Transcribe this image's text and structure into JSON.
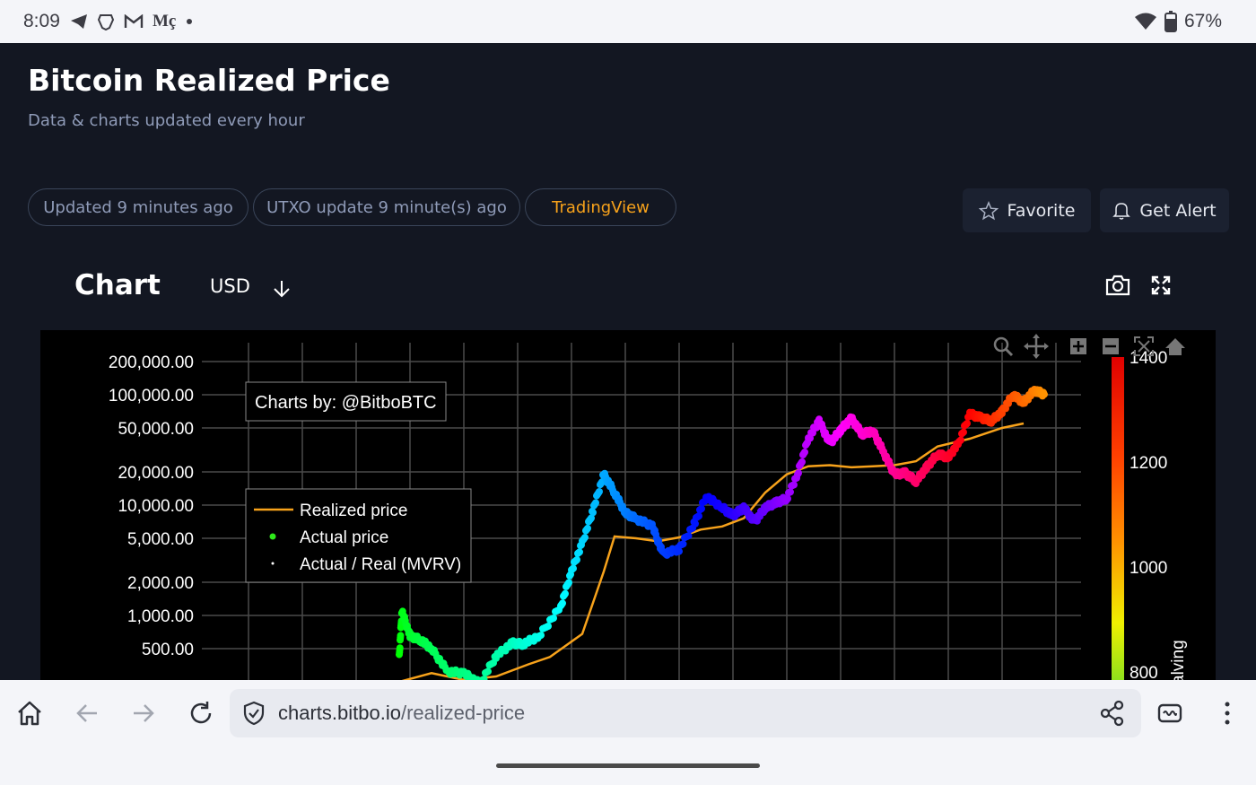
{
  "status_bar": {
    "time": "8:09",
    "notif_text": "Mç",
    "battery": "67%"
  },
  "page": {
    "title": "Bitcoin Realized Price",
    "subtitle": "Data & charts updated every hour",
    "pills": [
      "Updated 9 minutes ago",
      "UTXO update 9 minute(s) ago",
      "TradingView"
    ],
    "favorite_label": "Favorite",
    "alert_label": "Get Alert",
    "chart_heading": "Chart",
    "currency": "USD"
  },
  "chart_data": {
    "type": "scatter",
    "watermark": "Charts by: @BitboBTC",
    "y_scale": "log",
    "y_ticks": [
      "200,000.00",
      "100,000.00",
      "50,000.00",
      "20,000.00",
      "10,000.00",
      "5,000.00",
      "2,000.00",
      "1,000.00",
      "500.00"
    ],
    "legend": [
      "Realized price",
      "Actual price",
      "Actual / Real (MVRV)"
    ],
    "colorbar_ticks": [
      "1400",
      "1200",
      "1000",
      "800"
    ],
    "colorbar_title": "alving",
    "colors": {
      "realized": "#f7a21b",
      "grid": "#4a4a4a"
    },
    "realized_price": [
      [
        0.0,
        250
      ],
      [
        0.06,
        300
      ],
      [
        0.12,
        260
      ],
      [
        0.18,
        280
      ],
      [
        0.24,
        360
      ],
      [
        0.28,
        420
      ],
      [
        0.34,
        680
      ],
      [
        0.38,
        2500
      ],
      [
        0.4,
        5200
      ],
      [
        0.44,
        5000
      ],
      [
        0.48,
        4700
      ],
      [
        0.52,
        5100
      ],
      [
        0.56,
        6000
      ],
      [
        0.6,
        6400
      ],
      [
        0.64,
        7600
      ],
      [
        0.68,
        13000
      ],
      [
        0.72,
        19000
      ],
      [
        0.76,
        22500
      ],
      [
        0.8,
        23000
      ],
      [
        0.84,
        22000
      ],
      [
        0.88,
        22500
      ],
      [
        0.92,
        23000
      ],
      [
        0.96,
        25000
      ],
      [
        1.0,
        34000
      ],
      [
        1.06,
        40000
      ],
      [
        1.12,
        50000
      ],
      [
        1.16,
        55000
      ]
    ],
    "actual_price": [
      [
        0.0,
        420,
        120
      ],
      [
        0.005,
        1100,
        125
      ],
      [
        0.02,
        650,
        130
      ],
      [
        0.04,
        600,
        135
      ],
      [
        0.06,
        500,
        140
      ],
      [
        0.09,
        310,
        145
      ],
      [
        0.12,
        300,
        150
      ],
      [
        0.15,
        240,
        155
      ],
      [
        0.18,
        430,
        160
      ],
      [
        0.21,
        560,
        165
      ],
      [
        0.23,
        550,
        170
      ],
      [
        0.26,
        650,
        175
      ],
      [
        0.3,
        1200,
        180
      ],
      [
        0.32,
        2500,
        185
      ],
      [
        0.34,
        4500,
        190
      ],
      [
        0.36,
        9000,
        195
      ],
      [
        0.38,
        19000,
        200
      ],
      [
        0.4,
        13000,
        205
      ],
      [
        0.42,
        8500,
        210
      ],
      [
        0.44,
        7500,
        215
      ],
      [
        0.47,
        6500,
        220
      ],
      [
        0.49,
        3600,
        225
      ],
      [
        0.52,
        4000,
        230
      ],
      [
        0.55,
        7000,
        235
      ],
      [
        0.57,
        12000,
        240
      ],
      [
        0.6,
        9500,
        245
      ],
      [
        0.62,
        8000,
        250
      ],
      [
        0.64,
        9500,
        255
      ],
      [
        0.66,
        7000,
        260
      ],
      [
        0.68,
        9500,
        265
      ],
      [
        0.7,
        10500,
        270
      ],
      [
        0.72,
        11500,
        275
      ],
      [
        0.74,
        19000,
        280
      ],
      [
        0.76,
        40000,
        285
      ],
      [
        0.78,
        58000,
        290
      ],
      [
        0.8,
        36000,
        295
      ],
      [
        0.82,
        48000,
        300
      ],
      [
        0.84,
        61000,
        305
      ],
      [
        0.86,
        44000,
        310
      ],
      [
        0.88,
        47000,
        315
      ],
      [
        0.9,
        30000,
        320
      ],
      [
        0.92,
        19000,
        325
      ],
      [
        0.94,
        19500,
        330
      ],
      [
        0.96,
        16500,
        335
      ],
      [
        0.98,
        22000,
        340
      ],
      [
        1.0,
        29000,
        345
      ],
      [
        1.02,
        27000,
        350
      ],
      [
        1.04,
        37000,
        355
      ],
      [
        1.06,
        67000,
        360
      ],
      [
        1.08,
        62000,
        365
      ],
      [
        1.1,
        58000,
        370
      ],
      [
        1.12,
        70000,
        375
      ],
      [
        1.14,
        100000,
        380
      ],
      [
        1.16,
        85000,
        385
      ],
      [
        1.18,
        110000,
        390
      ],
      [
        1.2,
        100000,
        395
      ]
    ]
  },
  "browser": {
    "url_domain": "charts.bitbo.io",
    "url_path": "/realized-price"
  }
}
